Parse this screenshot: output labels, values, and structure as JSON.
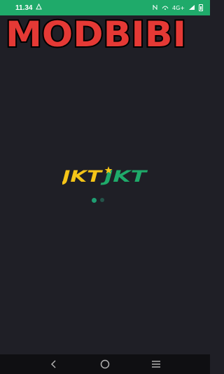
{
  "status_bar": {
    "time": "11.34",
    "right_text": "4G+",
    "icons": [
      "notification-icon",
      "nfc-icon",
      "hotspot-icon",
      "signal-icon",
      "battery-icon"
    ]
  },
  "watermark": {
    "text": "MODBIBI",
    "fill_color": "#e53935",
    "outline_color": "#000000"
  },
  "splash": {
    "logo_text_left": "JKT",
    "logo_text_right": "JKT",
    "logo_left_color": "#f5c518",
    "logo_right_color": "#1faa6a",
    "background_color": "#1f1f26"
  },
  "loader": {
    "active_dot_color": "#1f9e72",
    "inactive_dot_color": "#24544a"
  },
  "navigation": {
    "buttons": [
      "back-icon",
      "home-icon",
      "recents-icon"
    ]
  }
}
